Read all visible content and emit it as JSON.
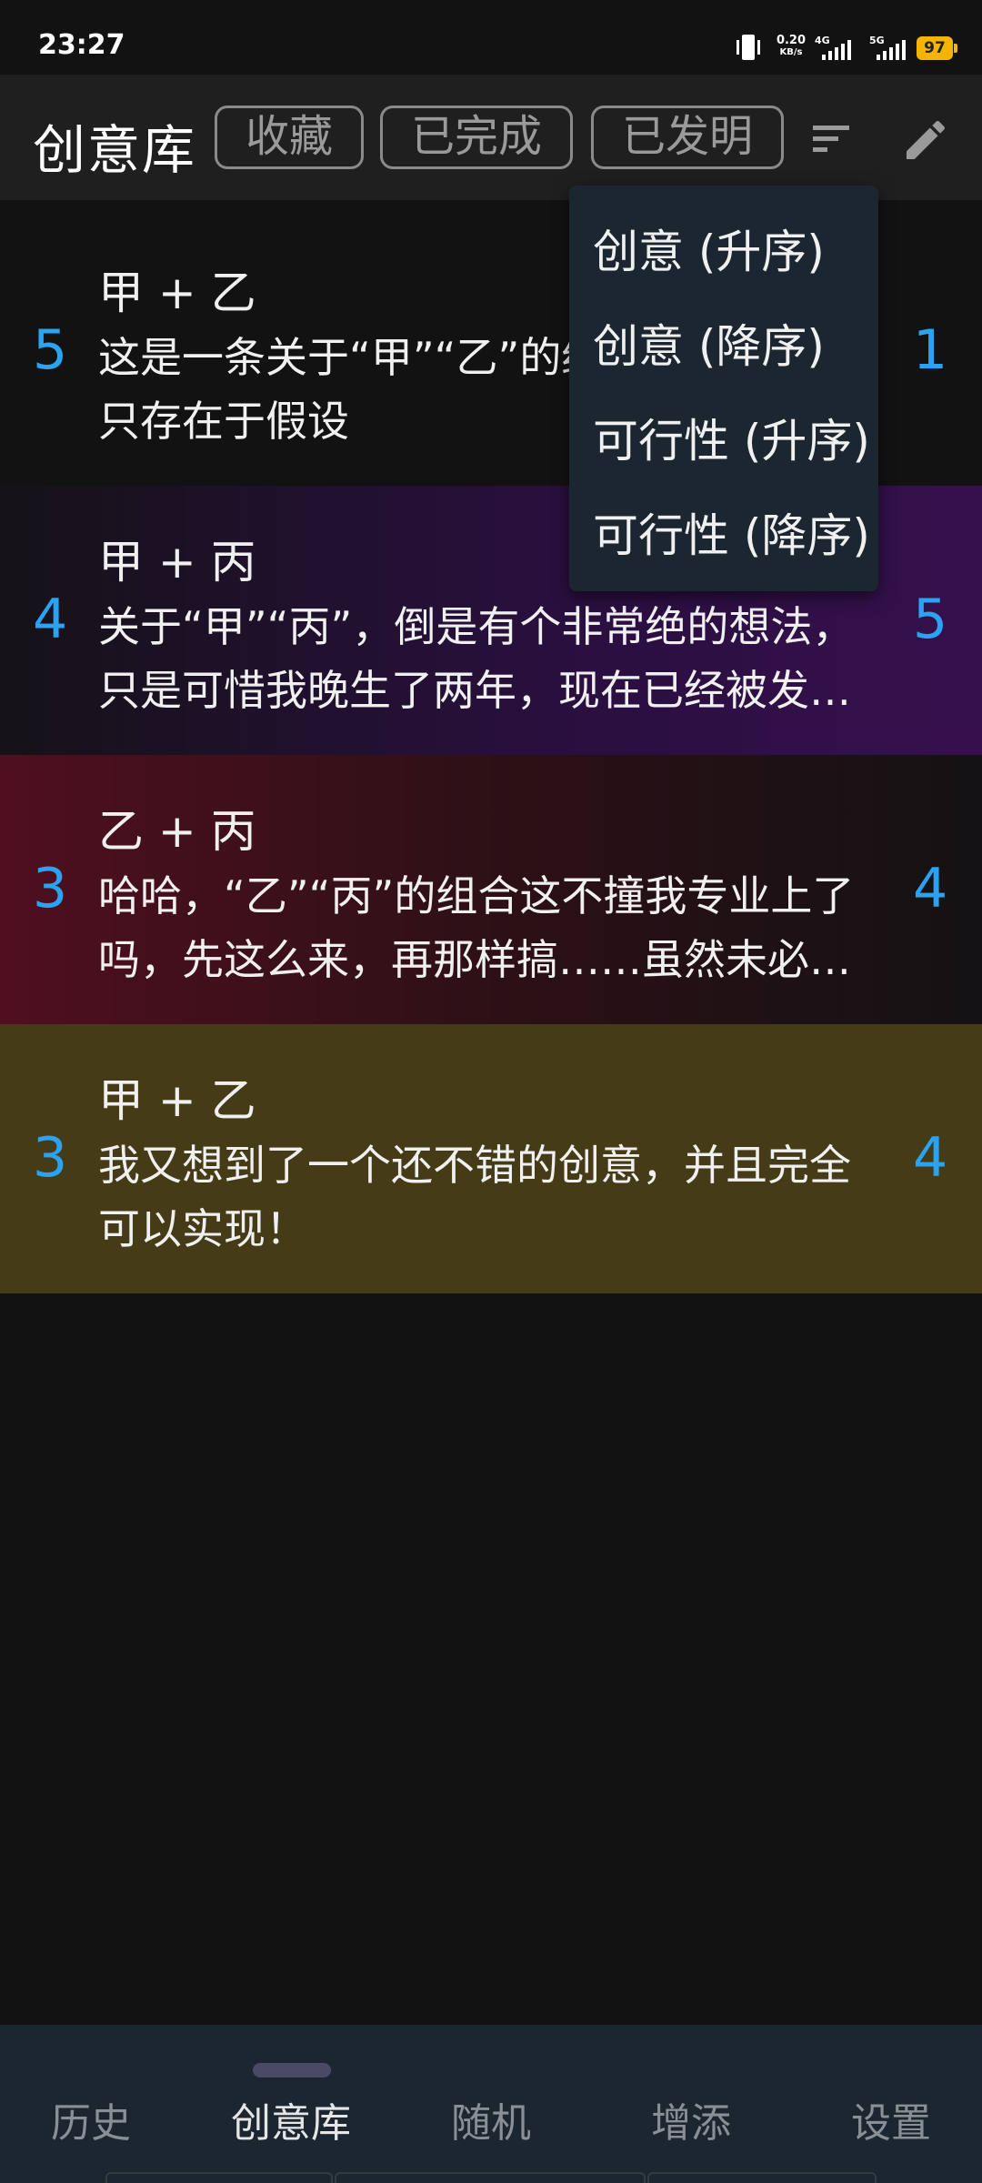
{
  "status_bar": {
    "time": "23:27",
    "net_speed_value": "0.20",
    "net_speed_unit": "KB/s",
    "signal_1_label": "4G",
    "signal_2_label": "5G",
    "battery": "97",
    "battery_color": "#f5b400"
  },
  "app_bar": {
    "title": "创意库",
    "chips": {
      "favorite": "收藏",
      "completed": "已完成",
      "invented": "已发明"
    },
    "sort_icon": "sort-icon",
    "edit_icon": "pencil-icon"
  },
  "sort_menu": {
    "items": [
      "创意 (升序)",
      "创意 (降序)",
      "可行性 (升序)",
      "可行性 (降序)"
    ]
  },
  "ideas": [
    {
      "left_score": "5",
      "title": "甲 + 乙",
      "text": "这是一条关于“甲”“乙”的绝妙创意，可惜只存在于假设",
      "right_score": "1",
      "background": "#121212"
    },
    {
      "left_score": "4",
      "title": "甲 + 丙",
      "text": "关于“甲”“丙”，倒是有个非常绝的想法，只是可惜我晚生了两年，现在已经被发…",
      "right_score": "5",
      "background": "#36104d"
    },
    {
      "left_score": "3",
      "title": "乙 + 丙",
      "text": "哈哈，“乙”“丙”的组合这不撞我专业上了吗，先这么来，再那样搞……虽然未必…",
      "right_score": "4",
      "background": "#4f0f1f"
    },
    {
      "left_score": "3",
      "title": "甲 + 乙",
      "text": "我又想到了一个还不错的创意，并且完全可以实现！",
      "right_score": "4",
      "background": "#453b17"
    }
  ],
  "score_color": "#2aa4f2",
  "bottom_nav": {
    "items": [
      "历史",
      "创意库",
      "随机",
      "增添",
      "设置"
    ],
    "active": "创意库"
  }
}
